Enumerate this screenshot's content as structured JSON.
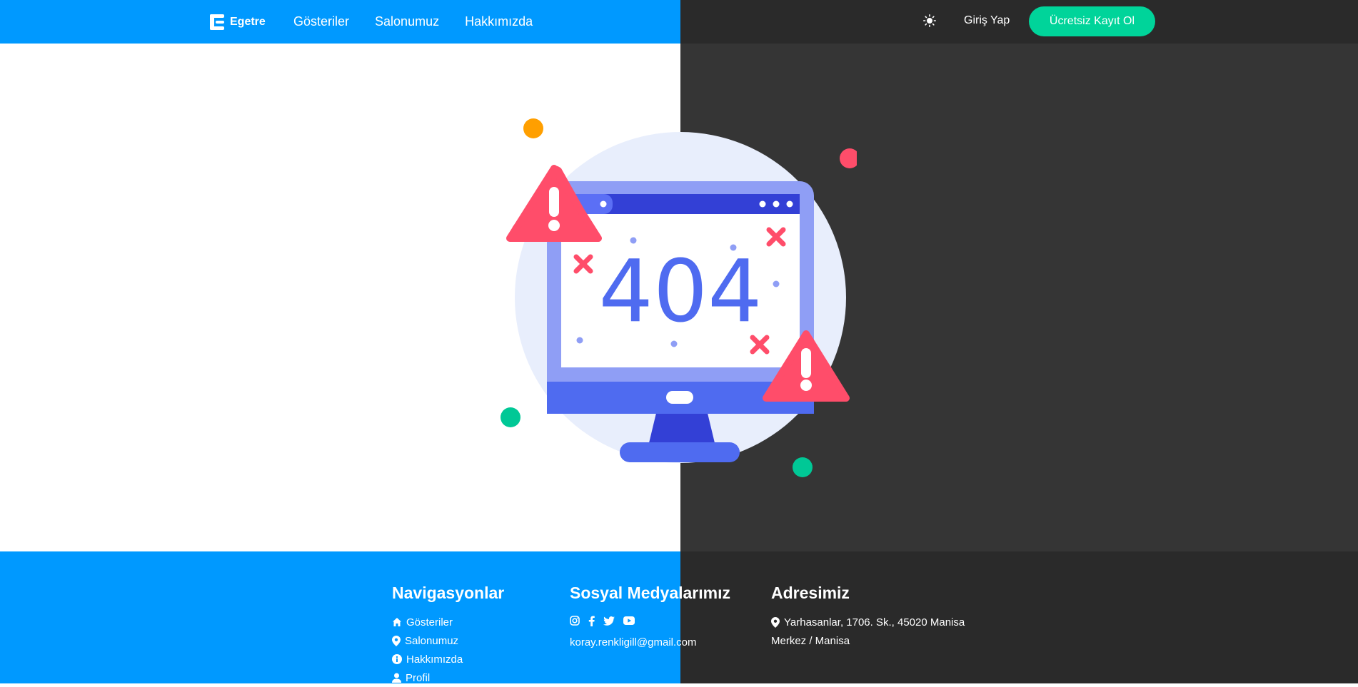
{
  "header": {
    "brand": "Egetre",
    "nav": [
      "Gösteriler",
      "Salonumuz",
      "Hakkımızda"
    ],
    "login": "Giriş Yap",
    "signup": "Ücretsiz Kayıt Ol"
  },
  "error": {
    "code": "404"
  },
  "footer": {
    "nav": {
      "title": "Navigasyonlar",
      "items": [
        {
          "label": "Gösteriler",
          "icon": "home-icon"
        },
        {
          "label": "Salonumuz",
          "icon": "location-pin-icon"
        },
        {
          "label": "Hakkımızda",
          "icon": "info-icon"
        },
        {
          "label": "Profil",
          "icon": "user-icon"
        }
      ]
    },
    "social": {
      "title": "Sosyal Medyalarımız",
      "icons": [
        "instagram-icon",
        "facebook-icon",
        "twitter-icon",
        "youtube-icon"
      ],
      "email": "koray.renkligill@gmail.com"
    },
    "address": {
      "title": "Adresimiz",
      "line1": "Yarhasanlar, 1706. Sk., 45020 Manisa",
      "line2": "Merkez / Manisa"
    }
  },
  "colors": {
    "primary": "#0099ff",
    "dark": "#353535",
    "accent": "#00d49a",
    "alert": "#ff4d6a"
  }
}
